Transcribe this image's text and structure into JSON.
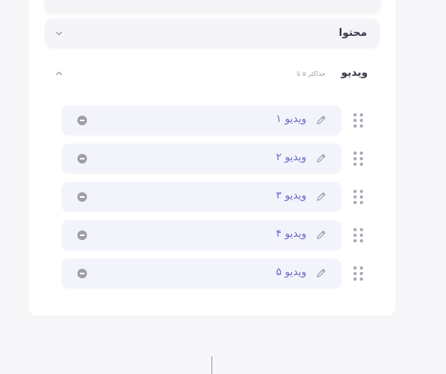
{
  "content_section": {
    "title": "محتوا",
    "chevron_icon": "chevron-down-icon"
  },
  "video_section": {
    "title": "ویدیو",
    "max_note": "حداکثر ۵ تا",
    "chevron_icon": "chevron-up-icon",
    "items": [
      {
        "label": "ویدیو ۱",
        "edit_icon": "pencil-icon",
        "remove_icon": "remove-circle-icon",
        "drag_icon": "drag-handle-icon"
      },
      {
        "label": "ویدیو ۲",
        "edit_icon": "pencil-icon",
        "remove_icon": "remove-circle-icon",
        "drag_icon": "drag-handle-icon"
      },
      {
        "label": "ویدیو ۳",
        "edit_icon": "pencil-icon",
        "remove_icon": "remove-circle-icon",
        "drag_icon": "drag-handle-icon"
      },
      {
        "label": "ویدیو ۴",
        "edit_icon": "pencil-icon",
        "remove_icon": "remove-circle-icon",
        "drag_icon": "drag-handle-icon"
      },
      {
        "label": "ویدیو ۵",
        "edit_icon": "pencil-icon",
        "remove_icon": "remove-circle-icon",
        "drag_icon": "drag-handle-icon"
      }
    ]
  },
  "colors": {
    "page_background": "#f7f7f9",
    "card_background": "#ffffff",
    "item_background": "#f3f3fc",
    "item_text": "#6a6ac8",
    "heading_text": "#3a3a4a",
    "muted_text": "#9a9aa6",
    "remove_icon": "#9e9ea6",
    "drag_icon": "#a9a9b7"
  }
}
